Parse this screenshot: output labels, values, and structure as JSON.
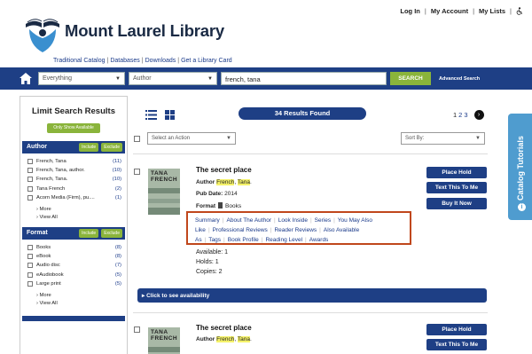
{
  "header": {
    "links": [
      "Log In",
      "My Account",
      "My Lists"
    ],
    "logo_text": "Mount Laurel Library",
    "sublinks": [
      "Traditional Catalog",
      "Databases",
      "Downloads",
      "Get a Library Card"
    ]
  },
  "search": {
    "scope": "Everything",
    "field": "Author",
    "query": "french, tana",
    "button": "SEARCH",
    "advanced": "Advanced Search"
  },
  "sidebar": {
    "title": "Limit Search Results",
    "show_available": "Only Show Available",
    "author": {
      "heading": "Author",
      "include": "Include",
      "exclude": "Exclude",
      "items": [
        {
          "label": "French, Tana",
          "count": "(11)"
        },
        {
          "label": "French, Tana, author.",
          "count": "(10)"
        },
        {
          "label": "French, Tana.",
          "count": "(10)"
        },
        {
          "label": "Tana French",
          "count": "(2)"
        },
        {
          "label": "Acorn Media (Firm), pu....",
          "count": "(1)"
        }
      ],
      "more": "More",
      "view_all": "View All"
    },
    "format": {
      "heading": "Format",
      "include": "Include",
      "exclude": "Exclude",
      "items": [
        {
          "label": "Books",
          "count": "(8)"
        },
        {
          "label": "eBook",
          "count": "(8)"
        },
        {
          "label": "Audio disc",
          "count": "(7)"
        },
        {
          "label": "eAudiobook",
          "count": "(5)"
        },
        {
          "label": "Large print",
          "count": "(5)"
        }
      ],
      "more": "More",
      "view_all": "View All"
    }
  },
  "toolbar": {
    "results": "34 Results Found",
    "pages": [
      "1",
      "2",
      "3"
    ],
    "action_placeholder": "Select an Action",
    "sort_placeholder": "Sort By:"
  },
  "results": [
    {
      "title": "The secret place",
      "author_label": "Author",
      "author_hl1": "French",
      "author_hl2": "Tana",
      "pub_label": "Pub Date:",
      "pub_date": "2014",
      "format_label": "Format",
      "format": "Books",
      "cover_text": "TANA FRENCH",
      "tabs_row1": [
        "Summary",
        "About The Author",
        "Look Inside",
        "Series",
        "You May Also"
      ],
      "tabs_row2": [
        "Like",
        "Professional Reviews",
        "Reader Reviews",
        "Also Available"
      ],
      "tabs_row3": [
        "As",
        "Tags",
        "Book Profile",
        "Reading Level",
        "Awards"
      ],
      "available": "Available: 1",
      "holds": "Holds: 1",
      "copies": "Copies: 2",
      "buttons": [
        "Place Hold",
        "Text This To Me",
        "Buy It Now"
      ],
      "availability_bar": "Click to see availability"
    },
    {
      "title": "The secret place",
      "author_label": "Author",
      "author_hl1": "French",
      "author_hl2": "Tana",
      "cover_text": "TANA FRENCH",
      "buttons": [
        "Place Hold",
        "Text This To Me"
      ]
    }
  ],
  "tutorials": "Catalog Tutorials",
  "colors": {
    "navy": "#1e3f85",
    "green": "#8ab43b",
    "tutorial_blue": "#4f9ccf",
    "highlight_box": "#c0471c"
  }
}
